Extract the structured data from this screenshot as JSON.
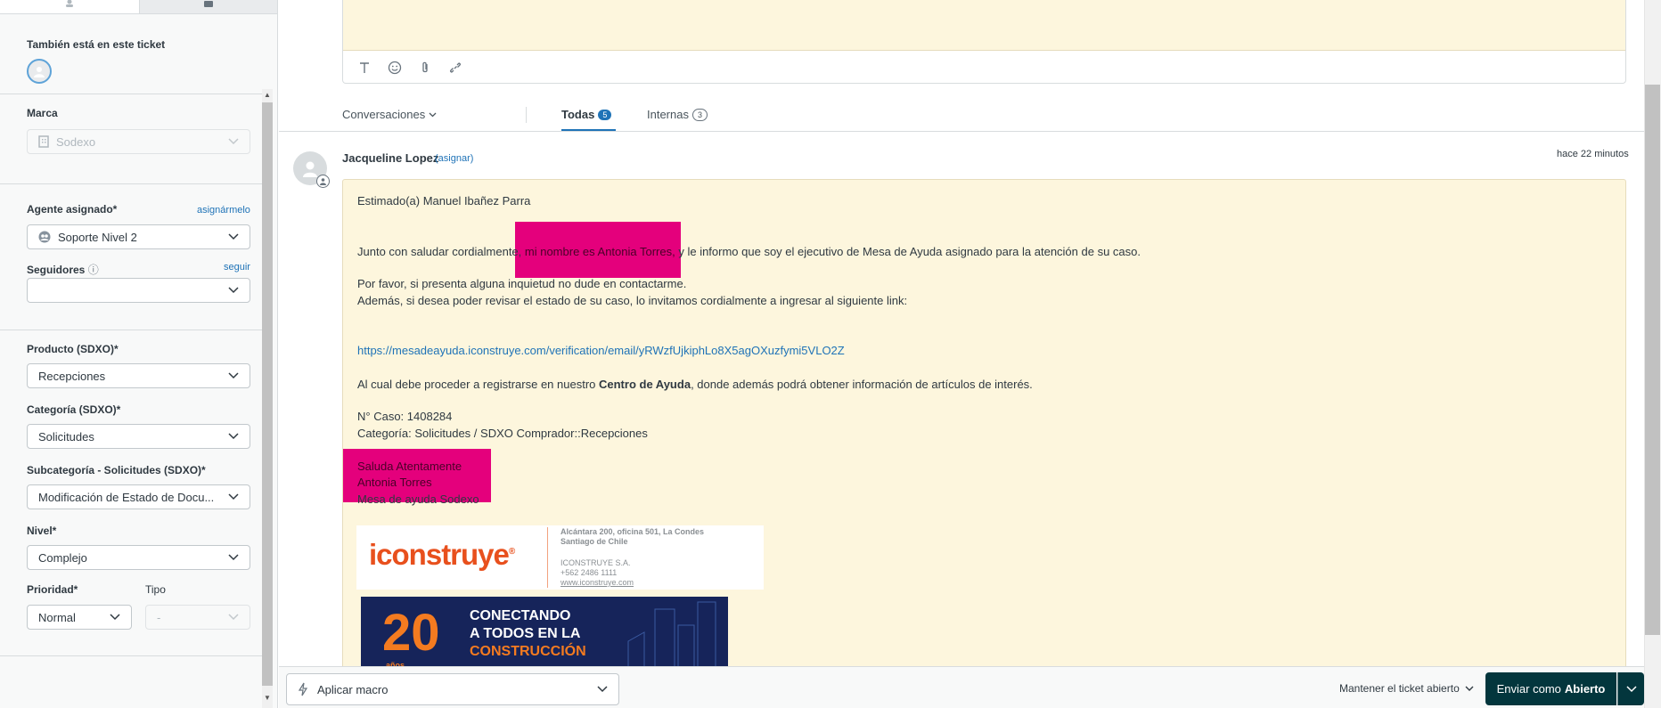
{
  "sidebar": {
    "also_in_ticket_label": "También está en este ticket",
    "brand": {
      "label": "Marca",
      "value": "Sodexo"
    },
    "assignee": {
      "label": "Agente asignado*",
      "link": "asignármelo",
      "value": "Soporte Nivel 2"
    },
    "followers": {
      "label": "Seguidores",
      "info_glyph": "ⓘ",
      "link": "seguir",
      "value": ""
    },
    "product": {
      "label": "Producto (SDXO)*",
      "value": "Recepciones"
    },
    "category": {
      "label": "Categoría (SDXO)*",
      "value": "Solicitudes"
    },
    "subcategory": {
      "label": "Subcategoría - Solicitudes (SDXO)*",
      "value": "Modificación de Estado de Docu..."
    },
    "level": {
      "label": "Nivel*",
      "value": "Complejo"
    },
    "priority": {
      "label": "Prioridad*",
      "value": "Normal"
    },
    "type": {
      "label": "Tipo",
      "value": "-"
    }
  },
  "tabs": {
    "conversations": "Conversaciones",
    "all": "Todas",
    "all_count": "5",
    "internal": "Internas",
    "internal_count": "3"
  },
  "message": {
    "author": "Jacqueline Lopez",
    "assign_link": "(asignar)",
    "timestamp": "hace 22 minutos",
    "greeting": "Estimado(a) Manuel Ibañez Parra",
    "intro_a": "Junto con saludar cordialmente, ",
    "intro_redacted": "mi nombre es Antonia Torres,",
    "intro_b": " y le informo que soy el ejecutivo de Mesa de Ayuda asignado para la atención de su caso.",
    "p2": "Por favor, si presenta alguna inquietud no dude en contactarme.",
    "p3": "Además, si desea poder revisar el estado de su caso, lo invitamos cordialmente a ingresar al siguiente link:",
    "link": "https://mesadeayuda.iconstruye.com/verification/email/yRWzfUjkiphLo8X5agOXuzfymi5VLO2Z",
    "p4_a": "Al cual debe proceder a registrarse en nuestro ",
    "p4_bold": "Centro de Ayuda",
    "p4_b": ", donde además podrá obtener información de artículos de interés.",
    "case_no": "N° Caso: 1408284",
    "category": "Categoría: Solicitudes / SDXO Comprador::Recepciones",
    "sign1": "Saluda Atentamente",
    "sign2": "Antonia Torres",
    "sign3": "Mesa de ayuda Sodexo"
  },
  "signature": {
    "logo": "iconstruye",
    "logo_mark": "®",
    "address1": "Alcántara 200, oficina 501, La Condes",
    "address2": "Santiago de Chile",
    "company": "ICONSTRUYE S.A.",
    "phone": "+562 2486 1111",
    "web": "www.iconstruye.com"
  },
  "banner": {
    "number": "20",
    "years": "años",
    "line1": "CONECTANDO",
    "line2": "A TODOS EN LA",
    "line3": "CONSTRUCCIÓN",
    "orange": "#f47b20",
    "navy": "#16245a"
  },
  "footer": {
    "macro": "Aplicar macro",
    "keep_open": "Mantener el ticket abierto",
    "send_prefix": "Enviar como",
    "send_status": "Abierto"
  },
  "colors": {
    "accent": "#1f73b7",
    "redaction": "#e4007c",
    "message_bg": "#fdf6dd",
    "send_button": "#03363d"
  }
}
